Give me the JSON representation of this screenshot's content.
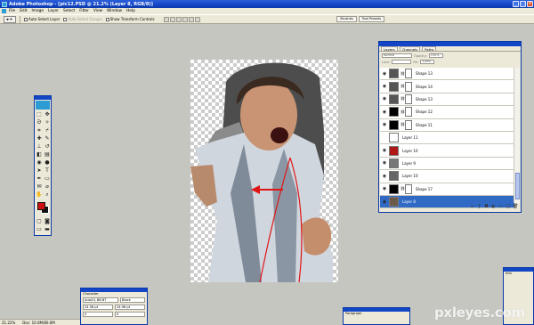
{
  "window": {
    "title": "Adobe Photoshop - [pic12.PSD @ 21.2% (Layer 8, RGB/8)]",
    "controls": [
      "_",
      "□",
      "×"
    ]
  },
  "menu": [
    "File",
    "Edit",
    "Image",
    "Layer",
    "Select",
    "Filter",
    "View",
    "Window",
    "Help"
  ],
  "options_bar": {
    "tool_preset": "▸+",
    "auto_select_layer": "Auto Select Layer",
    "auto_select_groups": "Auto Select Groups",
    "show_transform_controls": "Show Transform Controls"
  },
  "palette_well": {
    "tabs": [
      "Brushes",
      "Tool Presets"
    ]
  },
  "layers_panel": {
    "tabs": [
      "Layers",
      "Channels",
      "Paths"
    ],
    "blend_mode": "Normal",
    "opacity_label": "Opacity:",
    "opacity": "100%",
    "lock_label": "Lock:",
    "fill_label": "Fill:",
    "fill": "100%",
    "layers": [
      {
        "name": "Shape 13",
        "thumb": "#555555",
        "mask": true,
        "visible": true,
        "selected": false
      },
      {
        "name": "Shape 14",
        "thumb": "#555555",
        "mask": true,
        "visible": true,
        "selected": false
      },
      {
        "name": "Shape 13",
        "thumb": "#555555",
        "mask": true,
        "visible": true,
        "selected": false
      },
      {
        "name": "Shape 12",
        "thumb": "#000000",
        "mask": true,
        "visible": true,
        "selected": false
      },
      {
        "name": "Shape 11",
        "thumb": "#000000",
        "mask": true,
        "visible": true,
        "selected": false
      },
      {
        "name": "Layer 11",
        "thumb": "#ffffff",
        "mask": false,
        "visible": false,
        "selected": false
      },
      {
        "name": "Layer 10",
        "thumb": "#b01818",
        "mask": false,
        "visible": true,
        "selected": false
      },
      {
        "name": "Layer 9",
        "thumb": "#777777",
        "mask": false,
        "visible": true,
        "selected": false
      },
      {
        "name": "Layer 10",
        "thumb": "#666666",
        "mask": false,
        "visible": true,
        "selected": false
      },
      {
        "name": "Shape 17",
        "thumb": "#000000",
        "mask": true,
        "visible": true,
        "selected": false
      },
      {
        "name": "Layer 8",
        "thumb": "#6b5a4a",
        "mask": false,
        "visible": true,
        "selected": true
      }
    ]
  },
  "character_panel": {
    "tab": "Character",
    "font": "Arial21 BB BT",
    "style": "Black",
    "size": "24.58 pt",
    "leading": "24.96 pt",
    "tracking": "0",
    "kerning": "0"
  },
  "paragraph_panel": {
    "tab": "Paragraph"
  },
  "info_panel": {
    "tab": "Info"
  },
  "status_bar": {
    "zoom": "21.22%",
    "doc": "Doc: 10.0M/80.0M"
  },
  "tool_colors": {
    "foreground": "#d01010",
    "background": "#111111"
  },
  "watermark": "pxleyes.com"
}
